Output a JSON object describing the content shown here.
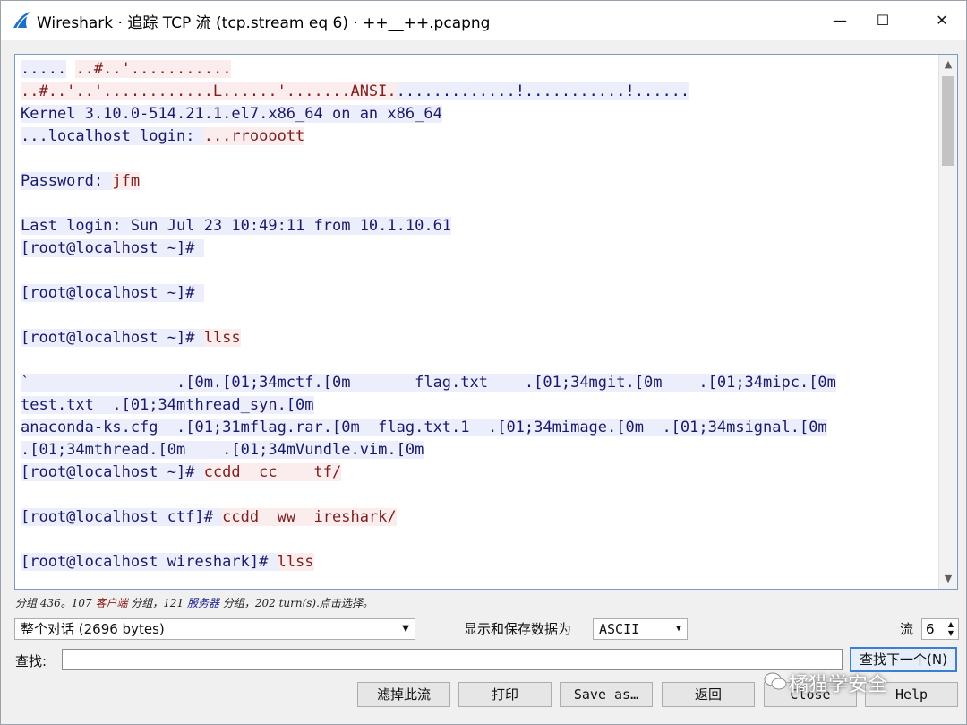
{
  "window": {
    "title": "Wireshark · 追踪 TCP 流 (tcp.stream eq 6) · ++__++.pcapng",
    "minimize": "—",
    "maximize": "☐",
    "close": "✕"
  },
  "stream": {
    "lines": [
      {
        "segs": [
          {
            "t": ".....",
            "k": "s"
          },
          {
            "t": " ",
            "k": ""
          },
          {
            "t": "..#..'...........",
            "k": "c"
          }
        ]
      },
      {
        "segs": [
          {
            "t": "..#..'..'............L......'.......ANSI.",
            "k": "c"
          },
          {
            "t": ".............!...........!......",
            "k": "s"
          }
        ]
      },
      {
        "segs": [
          {
            "t": "Kernel 3.10.0-514.21.1.el7.x86_64 on an x86_64",
            "k": "s"
          }
        ]
      },
      {
        "segs": [
          {
            "t": "...localhost login: ",
            "k": "s"
          },
          {
            "t": "...rroooott",
            "k": "c"
          }
        ]
      },
      {
        "segs": []
      },
      {
        "segs": [
          {
            "t": "Password: ",
            "k": "s"
          },
          {
            "t": "jfm",
            "k": "c"
          }
        ]
      },
      {
        "segs": []
      },
      {
        "segs": [
          {
            "t": "Last login: Sun Jul 23 10:49:11 from 10.1.10.61",
            "k": "s"
          }
        ]
      },
      {
        "segs": [
          {
            "t": "[root@localhost ~]# ",
            "k": "s"
          }
        ]
      },
      {
        "segs": []
      },
      {
        "segs": [
          {
            "t": "[root@localhost ~]# ",
            "k": "s"
          }
        ]
      },
      {
        "segs": []
      },
      {
        "segs": [
          {
            "t": "[root@localhost ~]# ",
            "k": "s"
          },
          {
            "t": "llss",
            "k": "c"
          }
        ]
      },
      {
        "segs": []
      },
      {
        "segs": [
          {
            "t": "`                .[0m.[01;34mctf.[0m       flag.txt    .[01;34mgit.[0m    .[01;34mipc.[0m",
            "k": "s"
          }
        ]
      },
      {
        "segs": [
          {
            "t": "test.txt  .[01;34mthread_syn.[0m",
            "k": "s"
          }
        ]
      },
      {
        "segs": [
          {
            "t": "anaconda-ks.cfg  .[01;31mflag.rar.[0m  flag.txt.1  .[01;34mimage.[0m  .[01;34msignal.[0m",
            "k": "s"
          }
        ]
      },
      {
        "segs": [
          {
            "t": ".[01;34mthread.[0m    .[01;34mVundle.vim.[0m",
            "k": "s"
          }
        ]
      },
      {
        "segs": [
          {
            "t": "[root@localhost ~]# ",
            "k": "s"
          },
          {
            "t": "ccdd  cc    tf/",
            "k": "c"
          }
        ]
      },
      {
        "segs": []
      },
      {
        "segs": [
          {
            "t": "[root@localhost ctf]# ",
            "k": "s"
          },
          {
            "t": "ccdd  ww  ireshark/",
            "k": "c"
          }
        ]
      },
      {
        "segs": []
      },
      {
        "segs": [
          {
            "t": "[root@localhost wireshark]# ",
            "k": "s"
          },
          {
            "t": "llss",
            "k": "c"
          }
        ]
      }
    ]
  },
  "status": {
    "prefix": "分组 436。107 ",
    "client": "客户端",
    "mid": " 分组，121 ",
    "server": "服务器",
    "suffix": " 分组，202 turn(s).点击选择。"
  },
  "controls": {
    "conversation": "整个对话 (2696 bytes)",
    "show_as_label": "显示和保存数据为",
    "show_as_value": "ASCII",
    "stream_label": "流",
    "stream_value": "6",
    "find_label": "查找:",
    "find_value": "",
    "find_next": "查找下一个(N)"
  },
  "buttons": {
    "filter_out": "滤掉此流",
    "print": "打印",
    "save_as": "Save as…",
    "back": "返回",
    "close": "Close",
    "help": "Help"
  },
  "watermark": "橘猫学安全",
  "colors": {
    "client_bg": "#fbeded",
    "client_fg": "#7d1f1f",
    "server_bg": "#edeefb",
    "server_fg": "#1a1a6a",
    "accent": "#3c7fd1"
  }
}
